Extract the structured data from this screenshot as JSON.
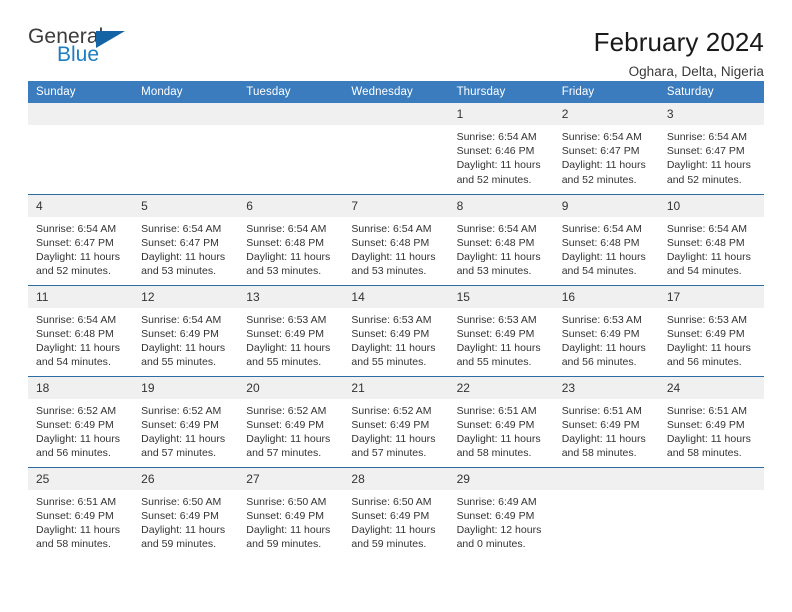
{
  "brand": {
    "name_top": "General",
    "name_bottom": "Blue",
    "color_dark": "#3b3b3b",
    "color_blue": "#1b7ec2",
    "triangle_color": "#1464a5"
  },
  "header": {
    "title": "February 2024",
    "subtitle": "Oghara, Delta, Nigeria"
  },
  "theme": {
    "header_row_bg": "#3a7cbe",
    "row_divider": "#2e6da4",
    "daynum_bg": "#f0f0f0",
    "text": "#333333"
  },
  "weekdays": [
    "Sunday",
    "Monday",
    "Tuesday",
    "Wednesday",
    "Thursday",
    "Friday",
    "Saturday"
  ],
  "weeks": [
    [
      {
        "day": "",
        "sunrise": "",
        "sunset": "",
        "daylight_l1": "",
        "daylight_l2": ""
      },
      {
        "day": "",
        "sunrise": "",
        "sunset": "",
        "daylight_l1": "",
        "daylight_l2": ""
      },
      {
        "day": "",
        "sunrise": "",
        "sunset": "",
        "daylight_l1": "",
        "daylight_l2": ""
      },
      {
        "day": "",
        "sunrise": "",
        "sunset": "",
        "daylight_l1": "",
        "daylight_l2": ""
      },
      {
        "day": "1",
        "sunrise": "Sunrise: 6:54 AM",
        "sunset": "Sunset: 6:46 PM",
        "daylight_l1": "Daylight: 11 hours",
        "daylight_l2": "and 52 minutes."
      },
      {
        "day": "2",
        "sunrise": "Sunrise: 6:54 AM",
        "sunset": "Sunset: 6:47 PM",
        "daylight_l1": "Daylight: 11 hours",
        "daylight_l2": "and 52 minutes."
      },
      {
        "day": "3",
        "sunrise": "Sunrise: 6:54 AM",
        "sunset": "Sunset: 6:47 PM",
        "daylight_l1": "Daylight: 11 hours",
        "daylight_l2": "and 52 minutes."
      }
    ],
    [
      {
        "day": "4",
        "sunrise": "Sunrise: 6:54 AM",
        "sunset": "Sunset: 6:47 PM",
        "daylight_l1": "Daylight: 11 hours",
        "daylight_l2": "and 52 minutes."
      },
      {
        "day": "5",
        "sunrise": "Sunrise: 6:54 AM",
        "sunset": "Sunset: 6:47 PM",
        "daylight_l1": "Daylight: 11 hours",
        "daylight_l2": "and 53 minutes."
      },
      {
        "day": "6",
        "sunrise": "Sunrise: 6:54 AM",
        "sunset": "Sunset: 6:48 PM",
        "daylight_l1": "Daylight: 11 hours",
        "daylight_l2": "and 53 minutes."
      },
      {
        "day": "7",
        "sunrise": "Sunrise: 6:54 AM",
        "sunset": "Sunset: 6:48 PM",
        "daylight_l1": "Daylight: 11 hours",
        "daylight_l2": "and 53 minutes."
      },
      {
        "day": "8",
        "sunrise": "Sunrise: 6:54 AM",
        "sunset": "Sunset: 6:48 PM",
        "daylight_l1": "Daylight: 11 hours",
        "daylight_l2": "and 53 minutes."
      },
      {
        "day": "9",
        "sunrise": "Sunrise: 6:54 AM",
        "sunset": "Sunset: 6:48 PM",
        "daylight_l1": "Daylight: 11 hours",
        "daylight_l2": "and 54 minutes."
      },
      {
        "day": "10",
        "sunrise": "Sunrise: 6:54 AM",
        "sunset": "Sunset: 6:48 PM",
        "daylight_l1": "Daylight: 11 hours",
        "daylight_l2": "and 54 minutes."
      }
    ],
    [
      {
        "day": "11",
        "sunrise": "Sunrise: 6:54 AM",
        "sunset": "Sunset: 6:48 PM",
        "daylight_l1": "Daylight: 11 hours",
        "daylight_l2": "and 54 minutes."
      },
      {
        "day": "12",
        "sunrise": "Sunrise: 6:54 AM",
        "sunset": "Sunset: 6:49 PM",
        "daylight_l1": "Daylight: 11 hours",
        "daylight_l2": "and 55 minutes."
      },
      {
        "day": "13",
        "sunrise": "Sunrise: 6:53 AM",
        "sunset": "Sunset: 6:49 PM",
        "daylight_l1": "Daylight: 11 hours",
        "daylight_l2": "and 55 minutes."
      },
      {
        "day": "14",
        "sunrise": "Sunrise: 6:53 AM",
        "sunset": "Sunset: 6:49 PM",
        "daylight_l1": "Daylight: 11 hours",
        "daylight_l2": "and 55 minutes."
      },
      {
        "day": "15",
        "sunrise": "Sunrise: 6:53 AM",
        "sunset": "Sunset: 6:49 PM",
        "daylight_l1": "Daylight: 11 hours",
        "daylight_l2": "and 55 minutes."
      },
      {
        "day": "16",
        "sunrise": "Sunrise: 6:53 AM",
        "sunset": "Sunset: 6:49 PM",
        "daylight_l1": "Daylight: 11 hours",
        "daylight_l2": "and 56 minutes."
      },
      {
        "day": "17",
        "sunrise": "Sunrise: 6:53 AM",
        "sunset": "Sunset: 6:49 PM",
        "daylight_l1": "Daylight: 11 hours",
        "daylight_l2": "and 56 minutes."
      }
    ],
    [
      {
        "day": "18",
        "sunrise": "Sunrise: 6:52 AM",
        "sunset": "Sunset: 6:49 PM",
        "daylight_l1": "Daylight: 11 hours",
        "daylight_l2": "and 56 minutes."
      },
      {
        "day": "19",
        "sunrise": "Sunrise: 6:52 AM",
        "sunset": "Sunset: 6:49 PM",
        "daylight_l1": "Daylight: 11 hours",
        "daylight_l2": "and 57 minutes."
      },
      {
        "day": "20",
        "sunrise": "Sunrise: 6:52 AM",
        "sunset": "Sunset: 6:49 PM",
        "daylight_l1": "Daylight: 11 hours",
        "daylight_l2": "and 57 minutes."
      },
      {
        "day": "21",
        "sunrise": "Sunrise: 6:52 AM",
        "sunset": "Sunset: 6:49 PM",
        "daylight_l1": "Daylight: 11 hours",
        "daylight_l2": "and 57 minutes."
      },
      {
        "day": "22",
        "sunrise": "Sunrise: 6:51 AM",
        "sunset": "Sunset: 6:49 PM",
        "daylight_l1": "Daylight: 11 hours",
        "daylight_l2": "and 58 minutes."
      },
      {
        "day": "23",
        "sunrise": "Sunrise: 6:51 AM",
        "sunset": "Sunset: 6:49 PM",
        "daylight_l1": "Daylight: 11 hours",
        "daylight_l2": "and 58 minutes."
      },
      {
        "day": "24",
        "sunrise": "Sunrise: 6:51 AM",
        "sunset": "Sunset: 6:49 PM",
        "daylight_l1": "Daylight: 11 hours",
        "daylight_l2": "and 58 minutes."
      }
    ],
    [
      {
        "day": "25",
        "sunrise": "Sunrise: 6:51 AM",
        "sunset": "Sunset: 6:49 PM",
        "daylight_l1": "Daylight: 11 hours",
        "daylight_l2": "and 58 minutes."
      },
      {
        "day": "26",
        "sunrise": "Sunrise: 6:50 AM",
        "sunset": "Sunset: 6:49 PM",
        "daylight_l1": "Daylight: 11 hours",
        "daylight_l2": "and 59 minutes."
      },
      {
        "day": "27",
        "sunrise": "Sunrise: 6:50 AM",
        "sunset": "Sunset: 6:49 PM",
        "daylight_l1": "Daylight: 11 hours",
        "daylight_l2": "and 59 minutes."
      },
      {
        "day": "28",
        "sunrise": "Sunrise: 6:50 AM",
        "sunset": "Sunset: 6:49 PM",
        "daylight_l1": "Daylight: 11 hours",
        "daylight_l2": "and 59 minutes."
      },
      {
        "day": "29",
        "sunrise": "Sunrise: 6:49 AM",
        "sunset": "Sunset: 6:49 PM",
        "daylight_l1": "Daylight: 12 hours",
        "daylight_l2": "and 0 minutes."
      },
      {
        "day": "",
        "sunrise": "",
        "sunset": "",
        "daylight_l1": "",
        "daylight_l2": ""
      },
      {
        "day": "",
        "sunrise": "",
        "sunset": "",
        "daylight_l1": "",
        "daylight_l2": ""
      }
    ]
  ]
}
